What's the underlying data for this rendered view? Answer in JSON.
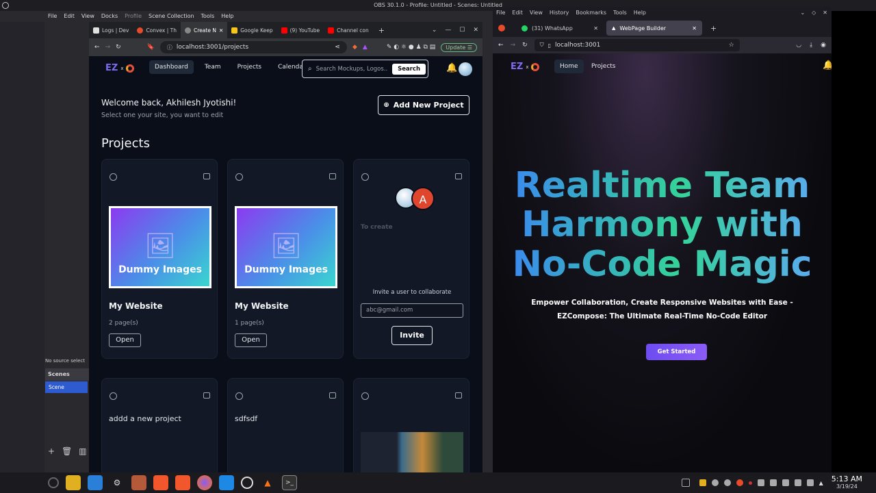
{
  "obs": {
    "title": "OBS 30.1.0 - Profile: Untitled - Scenes: Untitled",
    "menu": [
      "File",
      "Edit",
      "View",
      "Docks",
      "Profile",
      "Scene Collection",
      "Tools",
      "Help"
    ],
    "no_source": "No source select",
    "scenes_header": "Scenes",
    "scene_item": "Scene"
  },
  "brave": {
    "tabs": [
      {
        "label": "Logs | Dev",
        "color": "#e0e0e0"
      },
      {
        "label": "Convex | Th",
        "color": "#e84b2a"
      },
      {
        "label": "Create N",
        "color": "#e84b2a",
        "active": true
      },
      {
        "label": "Google Keep",
        "color": "#f5c518"
      },
      {
        "label": "(9) YouTube",
        "color": "#ff0000"
      },
      {
        "label": "Channel con",
        "color": "#ff0000"
      }
    ],
    "url": "localhost:3001/projects",
    "update_label": "Update"
  },
  "app": {
    "logo": "EZ",
    "logo_x": "x",
    "nav": [
      "Dashboard",
      "Team",
      "Projects",
      "Calendar"
    ],
    "search_placeholder": "Search Mockups, Logos...",
    "search_button": "Search",
    "welcome": "Welcome back, Akhilesh Jyotishi!",
    "subtitle": "Select one your site, you want to edit",
    "add_project": "Add New Project",
    "projects_heading": "Projects",
    "cards": [
      {
        "image_text": "Dummy Images",
        "title": "My Website",
        "pages": "2 page(s)",
        "open": "Open"
      },
      {
        "image_text": "Dummy Images",
        "title": "My Website",
        "pages": "1 page(s)",
        "open": "Open"
      }
    ],
    "invite_card": {
      "avatar_letter": "A",
      "create_text": "To create",
      "invite_label": "Invite a user to collaborate",
      "email_placeholder": "abc@gmail.com",
      "invite_button": "Invite"
    },
    "row2": [
      "addd a new project",
      "sdfsdf"
    ]
  },
  "firefox": {
    "menu": [
      "File",
      "Edit",
      "View",
      "History",
      "Bookmarks",
      "Tools",
      "Help"
    ],
    "tabs": [
      {
        "label": "(31) WhatsApp"
      },
      {
        "label": "WebPage Builder",
        "active": true
      }
    ],
    "url": "localhost:3001",
    "site": {
      "logo": "EZ",
      "logo_x": "x",
      "nav": [
        "Home",
        "Projects"
      ],
      "hero_lines": [
        "Realtime Team",
        "Harmony with",
        "No-Code Magic"
      ],
      "tagline_1": "Empower Collaboration, Create Responsive Websites with Ease -",
      "tagline_2": "EZCompose: The Ultimate Real-Time No-Code Editor",
      "cta": "Get Started"
    }
  },
  "taskbar": {
    "time": "5:13 AM",
    "date": "3/19/24"
  }
}
